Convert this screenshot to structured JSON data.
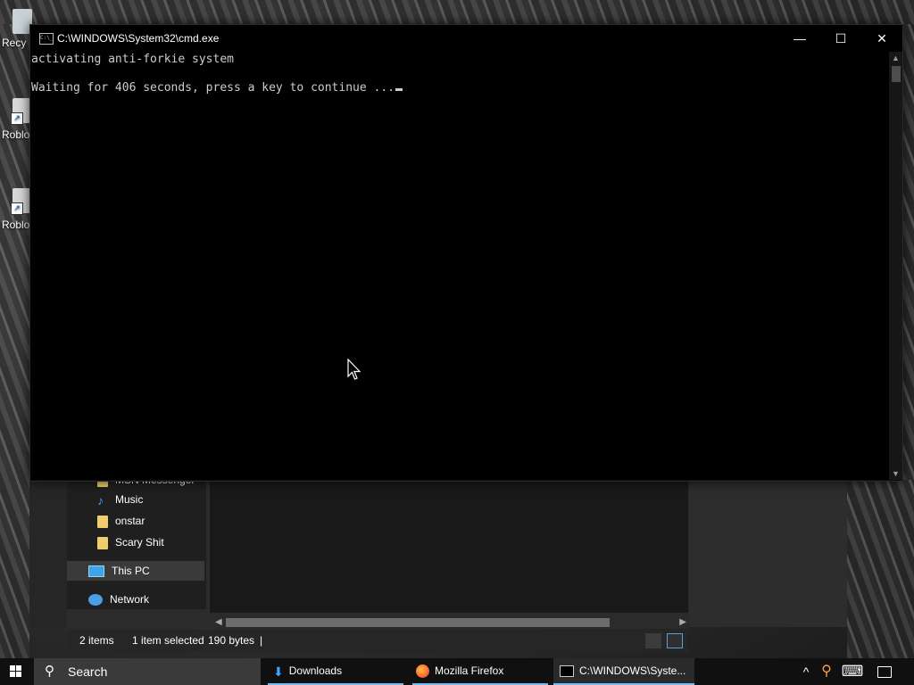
{
  "desktop": {
    "icons": [
      {
        "label": "Recy",
        "icon": "recycle-bin-icon"
      },
      {
        "label": "Roblo",
        "icon": "roblox-shortcut-icon"
      },
      {
        "label": "Roblo",
        "icon": "roblox-shortcut-icon"
      }
    ]
  },
  "cmd": {
    "title": "C:\\WINDOWS\\System32\\cmd.exe",
    "icon_text": "C:\\_",
    "lines": [
      "activating anti-forkie system",
      "",
      "Waiting for 406 seconds, press a key to continue ..."
    ],
    "buttons": {
      "minimize": "—",
      "maximize": "☐",
      "close": "✕"
    }
  },
  "explorer": {
    "nav_items": [
      {
        "label": "MSN Messenger",
        "icon": "folder-icon"
      },
      {
        "label": "Music",
        "icon": "music-icon"
      },
      {
        "label": "onstar",
        "icon": "folder-icon"
      },
      {
        "label": "Scary Shit",
        "icon": "folder-icon"
      },
      {
        "label": "This PC",
        "icon": "this-pc-icon"
      },
      {
        "label": "Network",
        "icon": "network-icon"
      }
    ],
    "status": {
      "items": "2 items",
      "selected": "1 item selected",
      "size": "190 bytes"
    }
  },
  "taskbar": {
    "search_label": "Search",
    "apps": [
      {
        "label": "Downloads",
        "icon": "download-folder-icon"
      },
      {
        "label": "Mozilla Firefox",
        "icon": "firefox-icon"
      },
      {
        "label": "C:\\WINDOWS\\Syste...",
        "icon": "cmd-icon"
      }
    ],
    "tray": {
      "chevron": "^",
      "keyboard": "⌨"
    }
  }
}
